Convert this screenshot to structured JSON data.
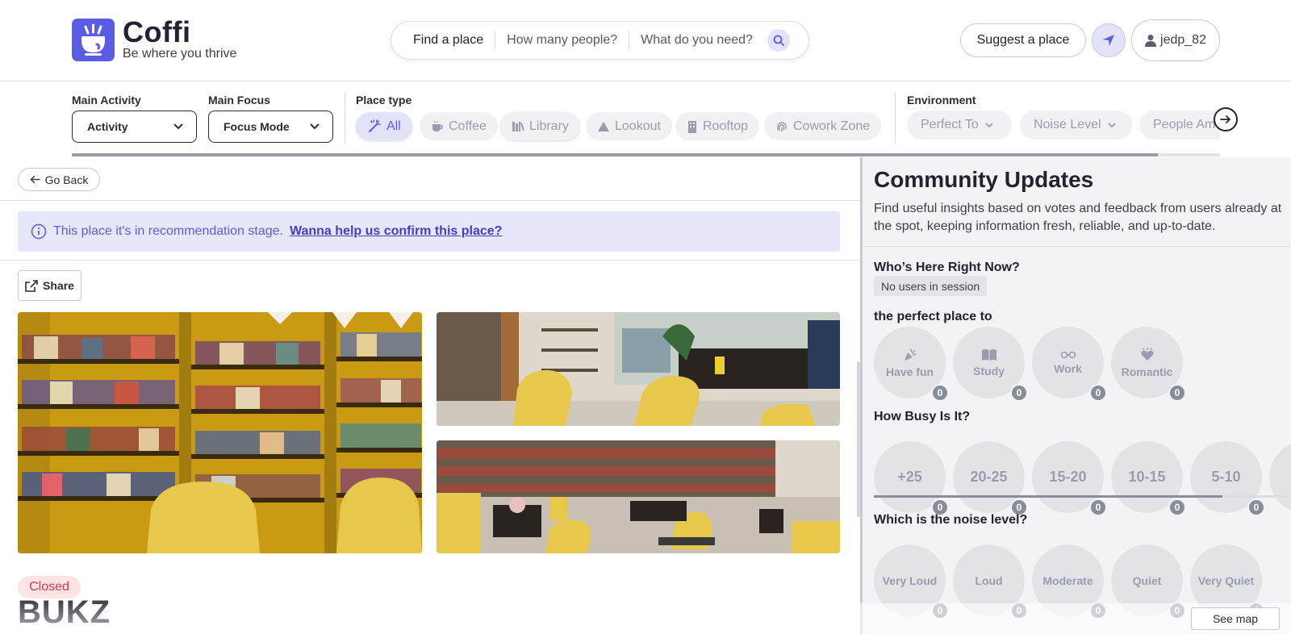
{
  "brand": {
    "name": "Coffi",
    "tagline": "Be where you thrive",
    "color": "#5b5ce6"
  },
  "search": {
    "find_label": "Find a place",
    "people_label": "How many people?",
    "need_label": "What do you need?"
  },
  "header": {
    "suggest_label": "Suggest a place",
    "username": "jedp_82"
  },
  "filters": {
    "main_activity_label": "Main Activity",
    "main_activity_value": "Activity",
    "main_focus_label": "Main Focus",
    "main_focus_value": "Focus Mode",
    "place_type_label": "Place type",
    "place_types": [
      {
        "label": "All",
        "icon": "magic-wand-icon",
        "active": true
      },
      {
        "label": "Coffee",
        "icon": "coffee-cup-icon"
      },
      {
        "label": "Library",
        "icon": "library-icon"
      },
      {
        "label": "Lookout",
        "icon": "mountain-icon"
      },
      {
        "label": "Rooftop",
        "icon": "building-icon"
      },
      {
        "label": "Cowork Zone",
        "icon": "fingerprint-icon"
      }
    ],
    "environment_label": "Environment",
    "environment": [
      "Perfect To",
      "Noise Level",
      "People Am"
    ]
  },
  "place": {
    "back_label": "Go Back",
    "banner_text": "This place it's in recommendation stage.",
    "banner_link": "Wanna help us confirm this place?",
    "share_label": "Share",
    "status": "Closed",
    "name": "BUKZ"
  },
  "community": {
    "title": "Community Updates",
    "description": "Find useful insights based on votes and feedback from users already at the spot, keeping information fresh, reliable, and up-to-date.",
    "whos_here_title": "Who’s Here Right Now?",
    "whos_here_value": "No users in session",
    "perfect_title": "the perfect place to",
    "perfect": [
      {
        "label": "Have fun",
        "icon": "party-popper-icon",
        "count": "0"
      },
      {
        "label": "Study",
        "icon": "book-icon",
        "count": "0"
      },
      {
        "label": "Work",
        "icon": "glasses-icon",
        "count": "0"
      },
      {
        "label": "Romantic",
        "icon": "heart-icon",
        "count": "0"
      }
    ],
    "busy_title": "How Busy Is It?",
    "busy": [
      {
        "label": "+25",
        "count": "0"
      },
      {
        "label": "20-25",
        "count": "0"
      },
      {
        "label": "15-20",
        "count": "0"
      },
      {
        "label": "10-15",
        "count": "0"
      },
      {
        "label": "5-10",
        "count": "0"
      }
    ],
    "noise_title": "Which is the noise level?",
    "noise": [
      {
        "label": "Very Loud",
        "count": "0"
      },
      {
        "label": "Loud",
        "count": "0"
      },
      {
        "label": "Moderate",
        "count": "0"
      },
      {
        "label": "Quiet",
        "count": "0"
      },
      {
        "label": "Very Quiet",
        "count": "0"
      }
    ],
    "see_map_label": "See map"
  }
}
